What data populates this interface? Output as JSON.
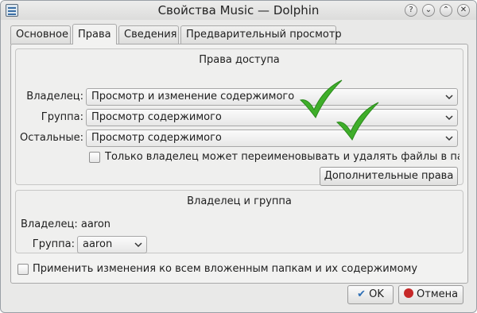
{
  "window": {
    "title": "Свойства Music — Dolphin",
    "controls": {
      "help": "?",
      "minimize": "⌄",
      "maximize": "⌃",
      "close": "✕"
    }
  },
  "tabs": [
    {
      "label": "Основное"
    },
    {
      "label": "Права"
    },
    {
      "label": "Сведения"
    },
    {
      "label": "Предварительный просмотр"
    }
  ],
  "permissions": {
    "title": "Права доступа",
    "owner": {
      "label": "Владелец:",
      "value": "Просмотр и изменение содержимого"
    },
    "group": {
      "label": "Группа:",
      "value": "Просмотр содержимого"
    },
    "others": {
      "label": "Остальные:",
      "value": "Просмотр содержимого"
    },
    "only_owner_rename": {
      "label": "Только владелец может переименовывать и удалять файлы в папке",
      "checked": false
    },
    "advanced_button": "Дополнительные права"
  },
  "ownership": {
    "title": "Владелец и группа",
    "owner_text": "Владелец: aaron",
    "group_label": "Группа:",
    "group_value": "aaron"
  },
  "apply_recursive": {
    "label": "Применить изменения ко всем вложенным папкам и их содержимому",
    "checked": false
  },
  "buttons": {
    "ok": "OK",
    "cancel": "Отмена"
  },
  "colors": {
    "checkmark_green": "#3fae2a",
    "cancel_red": "#c62828",
    "ok_blue": "#2f6fb5"
  }
}
